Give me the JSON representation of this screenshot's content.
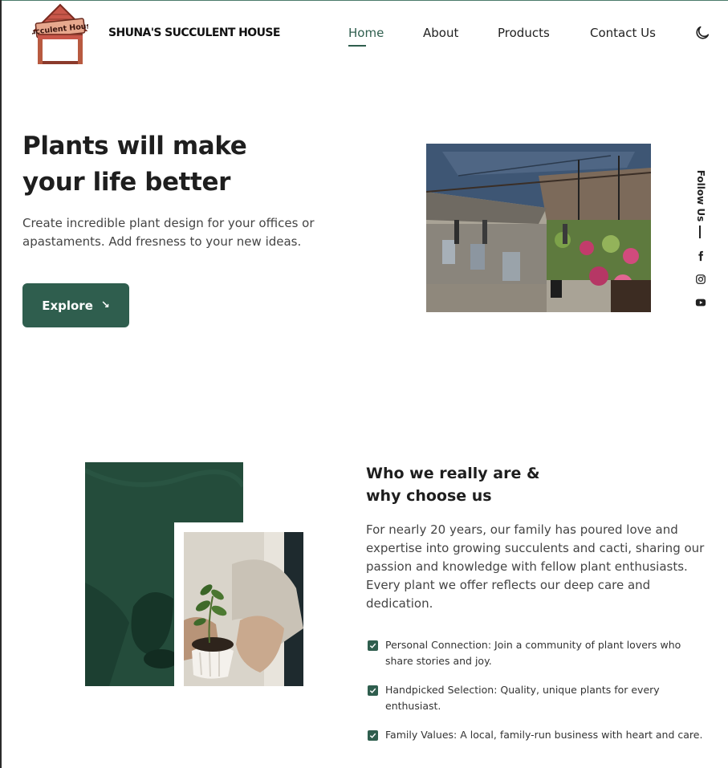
{
  "header": {
    "brand": "SHUNA'S SUCCULENT HOUSE",
    "logo_text": "Succulent House",
    "nav": [
      "Home",
      "About",
      "Products",
      "Contact Us"
    ],
    "active_nav": "Home",
    "theme_toggle_icon": "moon-icon"
  },
  "hero": {
    "title_line1": "Plants will make",
    "title_line2": "your life better",
    "description": "Create incredible plant design for your offices or apastaments. Add fresness to your new ideas.",
    "button_label": "Explore",
    "button_icon": "arrow-down-right-icon"
  },
  "follow": {
    "label": "Follow Us",
    "icons": [
      "facebook-icon",
      "instagram-icon",
      "youtube-icon"
    ]
  },
  "about": {
    "title_line1": "Who we really are &",
    "title_line2": "why choose us",
    "description": "For nearly 20 years, our family has poured love and expertise into growing succulents and cacti, sharing our passion and knowledge with fellow plant enthusiasts. Every plant we offer reflects our deep care and dedication.",
    "features": [
      "Personal Connection: Join a community of plant lovers who share stories and joy.",
      "Handpicked Selection: Quality, unique plants for every enthusiast.",
      "Family Values: A local, family-run business with heart and care."
    ]
  },
  "colors": {
    "accent": "#2f5e4e",
    "text": "#1e1e1e",
    "muted": "#444444"
  }
}
